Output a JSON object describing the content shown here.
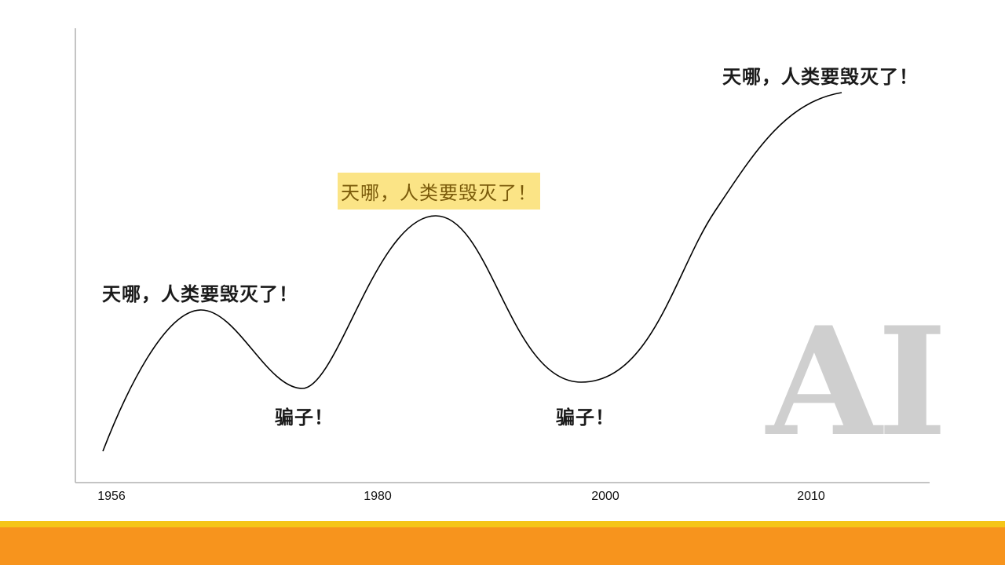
{
  "chart": {
    "x_ticks": [
      "1956",
      "1980",
      "2000",
      "2010"
    ],
    "curve_color": "#000000",
    "axis_color": "#b0b0b0"
  },
  "annotations": {
    "peak1": "天哪，人类要毁灭了！",
    "trough1": "骗子！",
    "peak2": "天哪，人类要毁灭了！",
    "trough2": "骗子！",
    "peak3": "天哪，人类要毁灭了！"
  },
  "logo": {
    "text": "AI",
    "color": "#cfcfcf"
  },
  "theme": {
    "highlight_bg": "#fbe486",
    "band_yellow": "#f5c518",
    "band_orange": "#f7941d"
  }
}
